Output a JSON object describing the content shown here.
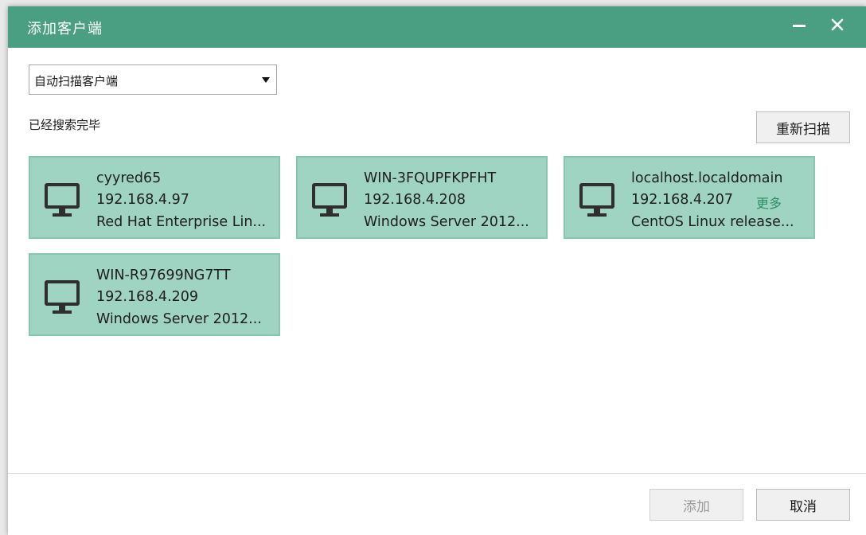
{
  "window": {
    "title": "添加客户端",
    "minimize_icon": "minimize-icon",
    "close_glyph": "✕"
  },
  "scan_mode": {
    "selected": "自动扫描客户端"
  },
  "status_text": "已经搜索完毕",
  "buttons": {
    "rescan": "重新扫描",
    "add": "添加",
    "cancel": "取消"
  },
  "more_link": "更多",
  "clients": [
    {
      "hostname": "cyyred65",
      "ip": "192.168.4.97",
      "os": "Red Hat Enterprise Lin..."
    },
    {
      "hostname": "WIN-3FQUPFKPFHT",
      "ip": "192.168.4.208",
      "os": "Windows Server 2012..."
    },
    {
      "hostname": "localhost.localdomain",
      "ip": "192.168.4.207",
      "os": "CentOS Linux release..."
    },
    {
      "hostname": "WIN-R97699NG7TT",
      "ip": "192.168.4.209",
      "os": "Windows Server 2012..."
    }
  ],
  "colors": {
    "titlebar": "#4a9e82",
    "card_bg": "#9fd3c2",
    "card_border": "#86c6b2",
    "link": "#2e8f66"
  }
}
